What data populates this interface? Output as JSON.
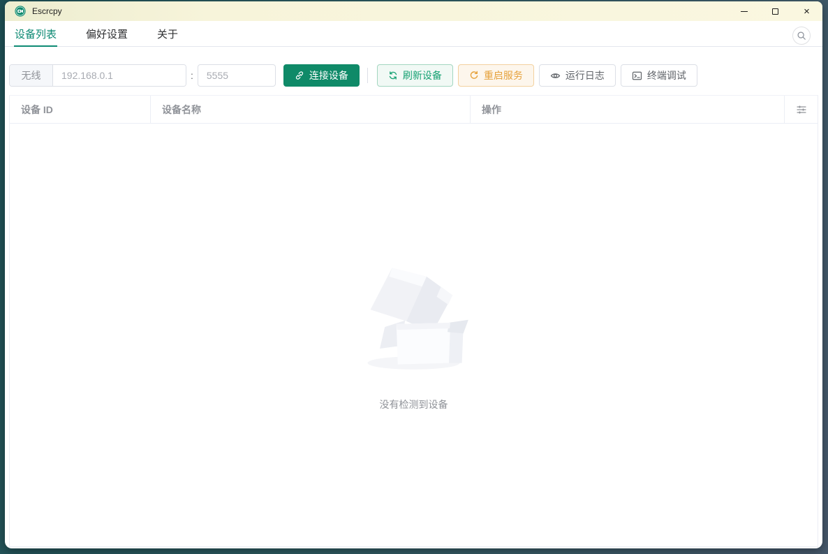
{
  "window": {
    "title": "Escrcpy"
  },
  "icons": {
    "app": "escrcpy-logo",
    "minimize": "–",
    "maximize": "□",
    "close": "×",
    "search": "magnifier",
    "connect": "link",
    "refresh": "refresh-arrows",
    "restart": "refresh-right",
    "log": "eye",
    "terminal": "terminal-window",
    "column_settings": "sliders",
    "empty_image": "open-box-illustration"
  },
  "tabs": [
    {
      "label": "设备列表",
      "active": true
    },
    {
      "label": "偏好设置",
      "active": false
    },
    {
      "label": "关于",
      "active": false
    }
  ],
  "toolbar": {
    "wireless_label": "无线",
    "ip_placeholder": "192.168.0.1",
    "port_separator": ":",
    "port_placeholder": "5555",
    "connect_label": "连接设备",
    "refresh_label": "刷新设备",
    "restart_label": "重启服务",
    "log_label": "运行日志",
    "terminal_label": "终端调试"
  },
  "device_table": {
    "columns": [
      {
        "label": "设备 ID"
      },
      {
        "label": "设备名称"
      },
      {
        "label": "操作"
      }
    ],
    "rows": [],
    "empty_text": "没有检测到设备"
  },
  "colors": {
    "primary": "#0e8a74",
    "primary_button": "#0f8a68",
    "success_light": "#16a173",
    "warning": "#e6a23c",
    "titlebar_bg": "#f8f5dc",
    "muted_text": "#909399",
    "border": "#dcdfe6",
    "table_border": "#ebeef5"
  }
}
